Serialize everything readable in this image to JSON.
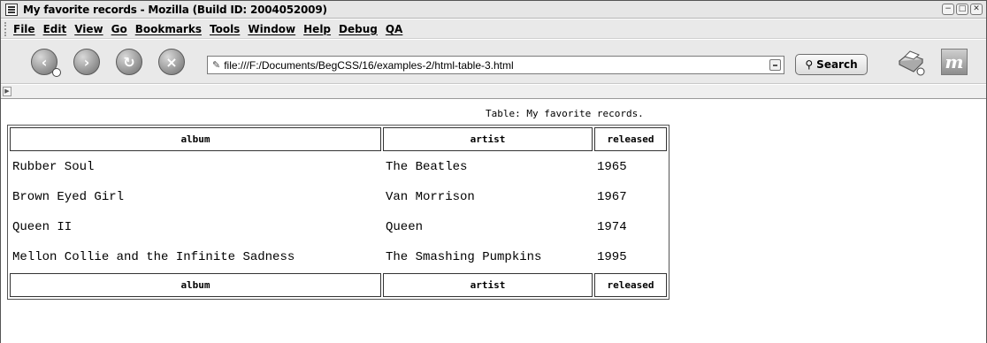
{
  "window": {
    "title": "My favorite records - Mozilla (Build ID: 2004052009)",
    "controls": [
      "−",
      "□",
      "✕"
    ]
  },
  "menu": {
    "items": [
      "File",
      "Edit",
      "View",
      "Go",
      "Bookmarks",
      "Tools",
      "Window",
      "Help",
      "Debug",
      "QA"
    ]
  },
  "toolbar": {
    "url": "file:///F:/Documents/BegCSS/16/examples-2/html-table-3.html",
    "search_label": "Search",
    "icons": [
      "back-icon",
      "forward-icon",
      "reload-icon",
      "stop-icon",
      "print-icon",
      "throbber-icon"
    ]
  },
  "page": {
    "caption": "Table: My favorite records.",
    "headers": [
      "album",
      "artist",
      "released"
    ],
    "rows": [
      [
        "Rubber Soul",
        "The Beatles",
        "1965"
      ],
      [
        "Brown Eyed Girl",
        "Van Morrison",
        "1967"
      ],
      [
        "Queen II",
        "Queen",
        "1974"
      ],
      [
        "Mellon Collie and the Infinite Sadness",
        "The Smashing Pumpkins",
        "1995"
      ]
    ],
    "footers": [
      "album",
      "artist",
      "released"
    ]
  }
}
